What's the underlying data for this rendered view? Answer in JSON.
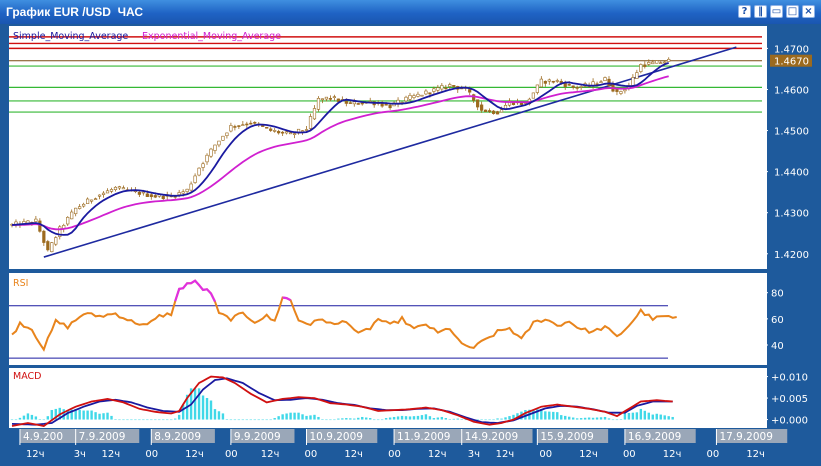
{
  "window": {
    "title": "График EUR /USD  ЧАС",
    "buttons": [
      {
        "name": "help-button",
        "glyph": "?"
      },
      {
        "name": "split-button",
        "glyph": "‖"
      },
      {
        "name": "minimize-button",
        "glyph": "▭"
      },
      {
        "name": "maximize-button",
        "glyph": "□"
      },
      {
        "name": "close-button",
        "glyph": "×"
      }
    ]
  },
  "main": {
    "legend_sma": "Simple_Moving_Average",
    "legend_ema": "Exponential_Moving_Average",
    "price_ticks": [
      "1.4700",
      "1.4600",
      "1.4500",
      "1.4400",
      "1.4300",
      "1.4200"
    ],
    "price_tick_values": [
      1.47,
      1.46,
      1.45,
      1.44,
      1.43,
      1.42
    ],
    "current_price": "1.4670",
    "current_price_value": 1.467,
    "red_levels": [
      1.4728,
      1.4712,
      1.47
    ],
    "green_levels": [
      1.4657,
      1.4605,
      1.4572,
      1.4545
    ],
    "trend_start": {
      "bar": 8,
      "price": 1.4192
    },
    "trend_end": {
      "bar": 182,
      "price": 1.4703
    },
    "ylim": [
      1.418,
      1.4735
    ]
  },
  "rsi": {
    "label": "RSI",
    "ticks": [
      "80",
      "60",
      "40"
    ],
    "tick_values": [
      80,
      60,
      40
    ],
    "levels": [
      70,
      30
    ],
    "ylim": [
      27,
      92
    ]
  },
  "macd": {
    "label": "MACD",
    "ticks": [
      "+0.010",
      "+0.005",
      "+0.000"
    ],
    "tick_values": [
      0.01,
      0.005,
      0.0
    ],
    "ylim": [
      -0.0015,
      0.0113
    ]
  },
  "time_axis": {
    "date_labels": [
      {
        "text": "4.9.200",
        "bar": 3
      },
      {
        "text": "7.9.2009",
        "bar": 17
      },
      {
        "text": "8.9.2009",
        "bar": 36
      },
      {
        "text": "9.9.2009",
        "bar": 56
      },
      {
        "text": "10.9.2009",
        "bar": 75
      },
      {
        "text": "11.9.2009",
        "bar": 97
      },
      {
        "text": "14.9.2009",
        "bar": 114
      },
      {
        "text": "15.9.2009",
        "bar": 133
      },
      {
        "text": "16.9.2009",
        "bar": 155
      },
      {
        "text": "17.9.2009",
        "bar": 178
      }
    ],
    "hour_labels": [
      {
        "text": "12ч",
        "bar": 3
      },
      {
        "text": "3ч",
        "bar": 15
      },
      {
        "text": "12ч",
        "bar": 22
      },
      {
        "text": "00",
        "bar": 33
      },
      {
        "text": "12ч",
        "bar": 43
      },
      {
        "text": "00",
        "bar": 53
      },
      {
        "text": "12ч",
        "bar": 62
      },
      {
        "text": "00",
        "bar": 73
      },
      {
        "text": "12ч",
        "bar": 83
      },
      {
        "text": "00",
        "bar": 94
      },
      {
        "text": "12ч",
        "bar": 104
      },
      {
        "text": "3ч",
        "bar": 114
      },
      {
        "text": "12ч",
        "bar": 121
      },
      {
        "text": "00",
        "bar": 132
      },
      {
        "text": "12ч",
        "bar": 142
      },
      {
        "text": "00",
        "bar": 153
      },
      {
        "text": "12ч",
        "bar": 163
      },
      {
        "text": "00",
        "bar": 174
      },
      {
        "text": "12ч",
        "bar": 184
      }
    ]
  },
  "colors": {
    "chart_bg": "#ffffff",
    "frame": "#1e5a9c",
    "candle": "#9c6a1e",
    "sma": "#1a1aa0",
    "ema": "#d020d0",
    "trend": "#1e2aa0",
    "red_level": "#d01010",
    "green_level": "#34b834",
    "rsi": "#e8841c",
    "rsi_hi": "#e030e0",
    "macd": "#d01010",
    "signal": "#1a1aa0",
    "hist": "#40d8e8",
    "label_box": "#9aa7b8",
    "price_tag": "#9c6a1e"
  },
  "chart_data": [
    {
      "type": "candlestick",
      "title": "График EUR /USD  ЧАС",
      "series": [
        {
          "name": "Simple_Moving_Average"
        },
        {
          "name": "Exponential_Moving_Average"
        }
      ],
      "ylim": [
        1.418,
        1.4735
      ],
      "anchors": [
        [
          0,
          1.427
        ],
        [
          6,
          1.428
        ],
        [
          9,
          1.4205
        ],
        [
          12,
          1.426
        ],
        [
          16,
          1.431
        ],
        [
          21,
          1.434
        ],
        [
          26,
          1.436
        ],
        [
          31,
          1.435
        ],
        [
          36,
          1.434
        ],
        [
          40,
          1.434
        ],
        [
          44,
          1.4355
        ],
        [
          47,
          1.441
        ],
        [
          51,
          1.4465
        ],
        [
          55,
          1.451
        ],
        [
          60,
          1.452
        ],
        [
          65,
          1.45
        ],
        [
          70,
          1.449
        ],
        [
          74,
          1.4505
        ],
        [
          77,
          1.4575
        ],
        [
          80,
          1.458
        ],
        [
          85,
          1.4565
        ],
        [
          90,
          1.457
        ],
        [
          95,
          1.456
        ],
        [
          100,
          1.458
        ],
        [
          105,
          1.4595
        ],
        [
          110,
          1.461
        ],
        [
          114,
          1.46
        ],
        [
          118,
          1.455
        ],
        [
          122,
          1.4545
        ],
        [
          125,
          1.457
        ],
        [
          129,
          1.4565
        ],
        [
          133,
          1.462
        ],
        [
          137,
          1.462
        ],
        [
          141,
          1.4605
        ],
        [
          145,
          1.461
        ],
        [
          149,
          1.4625
        ],
        [
          152,
          1.459
        ],
        [
          155,
          1.461
        ],
        [
          158,
          1.466
        ],
        [
          162,
          1.4665
        ],
        [
          165,
          1.467
        ]
      ]
    },
    {
      "type": "line",
      "title": "RSI",
      "ylim": [
        27,
        92
      ],
      "anchors": [
        [
          0,
          47
        ],
        [
          2,
          57
        ],
        [
          5,
          52
        ],
        [
          8,
          37
        ],
        [
          11,
          58
        ],
        [
          14,
          54
        ],
        [
          18,
          64
        ],
        [
          22,
          62
        ],
        [
          26,
          64
        ],
        [
          30,
          58
        ],
        [
          34,
          55
        ],
        [
          37,
          62
        ],
        [
          40,
          64
        ],
        [
          42,
          82
        ],
        [
          44,
          87
        ],
        [
          46,
          88
        ],
        [
          48,
          83
        ],
        [
          50,
          80
        ],
        [
          52,
          64
        ],
        [
          55,
          60
        ],
        [
          58,
          64
        ],
        [
          61,
          58
        ],
        [
          64,
          62
        ],
        [
          66,
          58
        ],
        [
          68,
          77
        ],
        [
          70,
          74
        ],
        [
          72,
          59
        ],
        [
          75,
          56
        ],
        [
          78,
          60
        ],
        [
          81,
          55
        ],
        [
          84,
          59
        ],
        [
          87,
          48
        ],
        [
          90,
          53
        ],
        [
          92,
          60
        ],
        [
          95,
          55
        ],
        [
          98,
          60
        ],
        [
          101,
          52
        ],
        [
          104,
          56
        ],
        [
          107,
          49
        ],
        [
          110,
          53
        ],
        [
          113,
          40
        ],
        [
          116,
          38
        ],
        [
          119,
          44
        ],
        [
          122,
          50
        ],
        [
          125,
          53
        ],
        [
          128,
          44
        ],
        [
          131,
          57
        ],
        [
          134,
          60
        ],
        [
          137,
          55
        ],
        [
          140,
          58
        ],
        [
          143,
          52
        ],
        [
          146,
          50
        ],
        [
          149,
          54
        ],
        [
          152,
          46
        ],
        [
          155,
          55
        ],
        [
          158,
          66
        ],
        [
          161,
          60
        ],
        [
          164,
          62
        ],
        [
          167,
          60
        ]
      ]
    },
    {
      "type": "line",
      "title": "MACD",
      "ylim": [
        -0.0015,
        0.0113
      ],
      "macd_anchors": [
        [
          0,
          -0.0015
        ],
        [
          4,
          -0.0008
        ],
        [
          8,
          -0.0015
        ],
        [
          12,
          0.0012
        ],
        [
          16,
          0.003
        ],
        [
          20,
          0.0042
        ],
        [
          24,
          0.0048
        ],
        [
          28,
          0.004
        ],
        [
          32,
          0.0025
        ],
        [
          36,
          0.0018
        ],
        [
          40,
          0.0014
        ],
        [
          42,
          0.002
        ],
        [
          44,
          0.005
        ],
        [
          47,
          0.0085
        ],
        [
          50,
          0.01
        ],
        [
          53,
          0.0098
        ],
        [
          56,
          0.0085
        ],
        [
          60,
          0.006
        ],
        [
          64,
          0.004
        ],
        [
          68,
          0.0048
        ],
        [
          72,
          0.0052
        ],
        [
          76,
          0.005
        ],
        [
          80,
          0.0038
        ],
        [
          84,
          0.0035
        ],
        [
          88,
          0.003
        ],
        [
          92,
          0.002
        ],
        [
          96,
          0.0022
        ],
        [
          100,
          0.0024
        ],
        [
          104,
          0.0028
        ],
        [
          108,
          0.0022
        ],
        [
          112,
          0.001
        ],
        [
          116,
          -0.0005
        ],
        [
          120,
          -0.0012
        ],
        [
          123,
          -0.0008
        ],
        [
          126,
          0.0
        ],
        [
          129,
          0.0015
        ],
        [
          133,
          0.003
        ],
        [
          137,
          0.0035
        ],
        [
          141,
          0.003
        ],
        [
          145,
          0.0025
        ],
        [
          149,
          0.0018
        ],
        [
          152,
          0.0008
        ],
        [
          155,
          0.0025
        ],
        [
          158,
          0.0042
        ],
        [
          162,
          0.0045
        ],
        [
          166,
          0.0042
        ]
      ],
      "signal_anchors": [
        [
          0,
          -0.001
        ],
        [
          6,
          -0.0012
        ],
        [
          10,
          -0.0008
        ],
        [
          14,
          0.0015
        ],
        [
          18,
          0.003
        ],
        [
          22,
          0.0042
        ],
        [
          26,
          0.0046
        ],
        [
          30,
          0.004
        ],
        [
          34,
          0.0028
        ],
        [
          38,
          0.002
        ],
        [
          42,
          0.0018
        ],
        [
          45,
          0.0035
        ],
        [
          48,
          0.007
        ],
        [
          51,
          0.0092
        ],
        [
          54,
          0.0096
        ],
        [
          58,
          0.0085
        ],
        [
          62,
          0.0062
        ],
        [
          66,
          0.0045
        ],
        [
          70,
          0.0046
        ],
        [
          74,
          0.005
        ],
        [
          78,
          0.0046
        ],
        [
          82,
          0.0038
        ],
        [
          86,
          0.0034
        ],
        [
          90,
          0.0026
        ],
        [
          94,
          0.0022
        ],
        [
          98,
          0.0022
        ],
        [
          102,
          0.0025
        ],
        [
          106,
          0.0026
        ],
        [
          110,
          0.0018
        ],
        [
          114,
          0.0005
        ],
        [
          118,
          -0.0006
        ],
        [
          122,
          -0.0008
        ],
        [
          126,
          -0.0002
        ],
        [
          130,
          0.0012
        ],
        [
          134,
          0.0026
        ],
        [
          138,
          0.0032
        ],
        [
          142,
          0.003
        ],
        [
          146,
          0.0024
        ],
        [
          150,
          0.0016
        ],
        [
          154,
          0.0016
        ],
        [
          157,
          0.0032
        ],
        [
          161,
          0.0042
        ],
        [
          166,
          0.0042
        ]
      ]
    }
  ]
}
